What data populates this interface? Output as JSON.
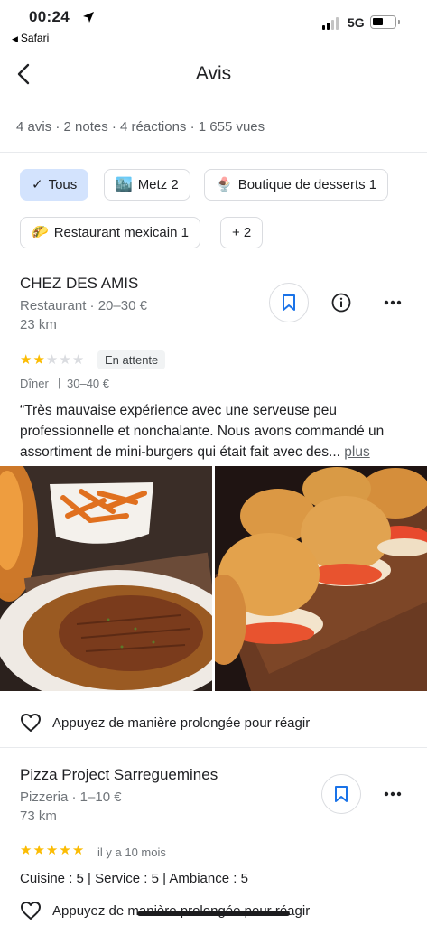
{
  "status_bar": {
    "time": "00:24",
    "back_app": "Safari",
    "network": "5G"
  },
  "header": {
    "title": "Avis"
  },
  "stats": "4 avis · 2 notes · 4 réactions · 1 655 vues",
  "filters": [
    {
      "icon": "✓",
      "label": "Tous"
    },
    {
      "icon": "🏙️",
      "label": "Metz 2"
    },
    {
      "icon": "🍨",
      "label": "Boutique de desserts 1"
    },
    {
      "icon": "🌮",
      "label": "Restaurant mexicain 1"
    },
    {
      "icon": "",
      "label": "+ 2"
    }
  ],
  "reviews": [
    {
      "name": "CHEZ DES AMIS",
      "category": "Restaurant · 20–30 €",
      "distance": "23 km",
      "rating": 2,
      "status": "En attente",
      "meal": "Dîner",
      "price": "30–40 €",
      "text": "“Très mauvaise expérience avec une serveuse peu professionnelle et nonchalante. Nous avons commandé un assortiment de mini-burgers qui était fait avec des...",
      "more": "plus",
      "photos": [
        "steak-with-sauce-and-sweet-potato-fries",
        "mini-burgers-on-wooden-board"
      ],
      "reaction_hint": "Appuyez de manière prolongée pour réagir"
    },
    {
      "name": "Pizza Project Sarreguemines",
      "category": "Pizzeria · 1–10 €",
      "distance": "73 km",
      "rating": 5,
      "time_ago": "il y a 10 mois",
      "criteria": "Cuisine : 5 | Service : 5 | Ambiance : 5",
      "reaction_hint": "Appuyez de manière prolongée pour réagir"
    }
  ],
  "colors": {
    "accent": "#1a73e8",
    "chip_selected": "#d3e3fd",
    "star": "#fbbc04",
    "text_secondary": "#70757a"
  }
}
